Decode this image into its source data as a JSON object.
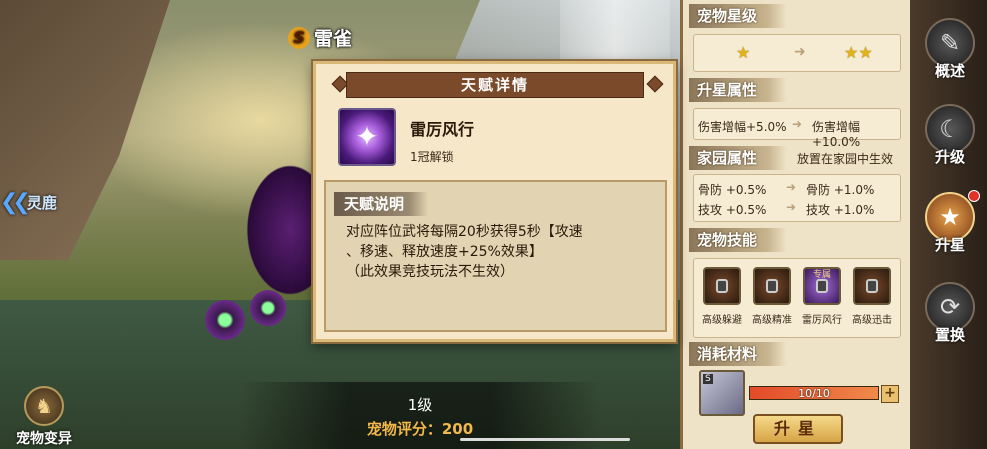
{
  "pet": {
    "rank": "S",
    "name": "雷雀"
  },
  "nav": {
    "prev": "灵鹿"
  },
  "mutate": {
    "label": "宠物变异"
  },
  "info": {
    "level": "1级",
    "score": "宠物评分：200"
  },
  "panel": {
    "star_title": "宠物星级",
    "star_from": "★",
    "star_to": "★★",
    "upgrade_title": "升星属性",
    "upgrade_from": "伤害增幅+5.0%",
    "upgrade_to": "伤害增幅+10.0%",
    "home_title": "家园属性",
    "home_note": "放置在家园中生效",
    "home_rows": [
      {
        "from": "骨防 +0.5%",
        "to": "骨防 +1.0%"
      },
      {
        "from": "技攻 +0.5%",
        "to": "技攻 +1.0%"
      }
    ],
    "skills_title": "宠物技能",
    "skills": [
      {
        "name": "高级躲避",
        "tag": ""
      },
      {
        "name": "高级精准",
        "tag": ""
      },
      {
        "name": "雷厉风行",
        "tag": "专属"
      },
      {
        "name": "高级迅击",
        "tag": ""
      }
    ],
    "material_title": "消耗材料",
    "material_badge": "S",
    "material_count": "10/10",
    "material_progress": 1.0,
    "upgrade_button": "升星"
  },
  "tabs": [
    {
      "label": "概述",
      "icon": "scroll-icon"
    },
    {
      "label": "升级",
      "icon": "upgrade-icon"
    },
    {
      "label": "升星",
      "icon": "star-icon"
    },
    {
      "label": "置换",
      "icon": "swap-icon"
    }
  ],
  "modal": {
    "title": "天赋详情",
    "talent_name": "雷厉风行",
    "unlock": "1冠解锁",
    "desc_title": "天赋说明",
    "desc_line1": "对应阵位武将每隔20秒获得5秒【攻速",
    "desc_line2": "、移速、释放速度+25%效果】",
    "desc_line3": "（此效果竞技玩法不生效）"
  }
}
